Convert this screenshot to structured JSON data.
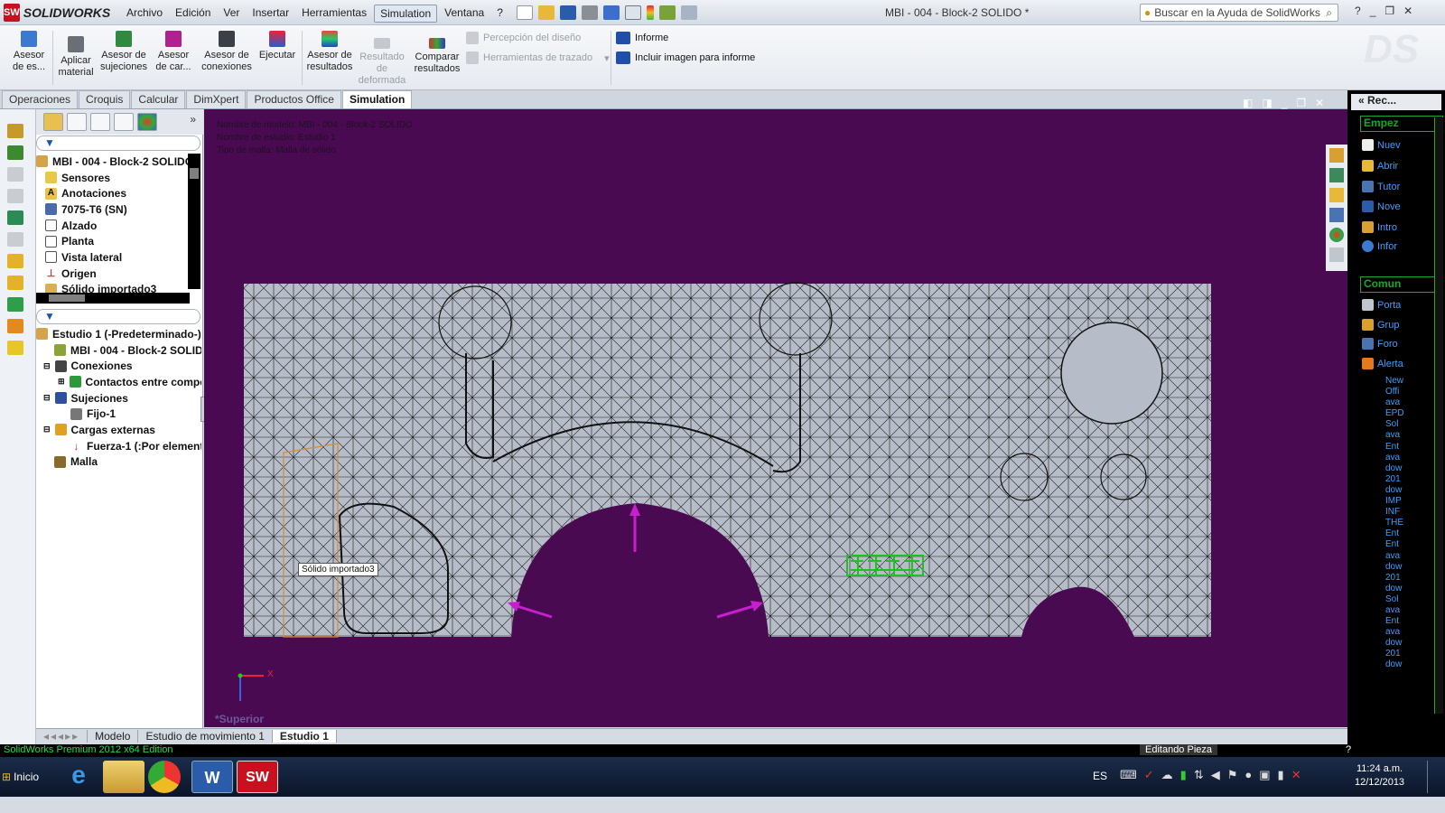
{
  "app": {
    "logo_letters": "SW",
    "logo_text": "SOLIDWORKS",
    "doc_title": "MBI - 004 - Block-2 SOLIDO *"
  },
  "menu": [
    "Archivo",
    "Edición",
    "Ver",
    "Insertar",
    "Herramientas",
    "Simulation",
    "Ventana",
    "?"
  ],
  "help_search": {
    "placeholder": "Buscar en la Ayuda de SolidWorks"
  },
  "ribbon": {
    "buttons": [
      {
        "label": "Asesor de es..."
      },
      {
        "label": "Aplicar material"
      },
      {
        "label": "Asesor de sujeciones"
      },
      {
        "label": "Asesor de car..."
      },
      {
        "label": "Asesor de conexiones"
      },
      {
        "label": "Ejecutar"
      },
      {
        "label": "Asesor de resultados"
      },
      {
        "label": "Resultado de deformada"
      },
      {
        "label": "Comparar resultados"
      }
    ],
    "small": [
      "Percepción del diseño",
      "Herramientas de trazado",
      "Informe",
      "Incluir imagen para informe"
    ]
  },
  "cmd_tabs": [
    "Operaciones",
    "Croquis",
    "Calcular",
    "DimXpert",
    "Productos Office",
    "Simulation"
  ],
  "feature_tree": [
    {
      "label": "MBI - 004 - Block-2 SOLIDO",
      "icon": "part-icon"
    },
    {
      "label": "Sensores",
      "icon": "sensor-icon"
    },
    {
      "label": "Anotaciones",
      "icon": "annotation-icon"
    },
    {
      "label": "7075-T6 (SN)",
      "icon": "material-icon"
    },
    {
      "label": "Alzado",
      "icon": "plane-icon"
    },
    {
      "label": "Planta",
      "icon": "plane-icon"
    },
    {
      "label": "Vista lateral",
      "icon": "plane-icon"
    },
    {
      "label": "Origen",
      "icon": "origin-icon"
    },
    {
      "label": "Sólido importado3",
      "icon": "solid-icon"
    }
  ],
  "study_tree": [
    {
      "label": "Estudio 1 (-Predeterminado-)",
      "icon": "study-icon"
    },
    {
      "label": "MBI - 004 - Block-2 SOLIDO",
      "icon": "part-icon"
    },
    {
      "label": "Conexiones",
      "icon": "connections-icon"
    },
    {
      "label": "Contactos entre componentes",
      "icon": "contact-icon"
    },
    {
      "label": "Sujeciones",
      "icon": "fixture-icon"
    },
    {
      "label": "Fijo-1",
      "icon": "fixed-icon"
    },
    {
      "label": "Cargas externas",
      "icon": "loads-icon"
    },
    {
      "label": "Fuerza-1 (:Por elemento:)",
      "icon": "force-icon"
    },
    {
      "label": "Malla",
      "icon": "mesh-icon"
    }
  ],
  "graphics": {
    "info_lines": [
      "Nombre de modelo: MBI - 004 - Block-2 SOLIDO",
      "Nombre de estudio: Estudio 1",
      "Tipo de malla: Malla de sólido"
    ],
    "tooltip": "Sólido importado3",
    "view_label": "*Superior",
    "axis_x": "X"
  },
  "bottom_tabs": [
    "Modelo",
    "Estudio de movimiento 1",
    "Estudio 1"
  ],
  "task_pane": {
    "header": "« Rec...",
    "section1": "Empez",
    "links1": [
      "Nuev",
      "Abrir",
      "Tutor",
      "Nove",
      "Intro",
      "Infor"
    ],
    "section2": "Comun",
    "links2": [
      "Porta",
      "Grup",
      "Foro",
      "Alerta"
    ],
    "news": [
      "New",
      "Offi",
      "ava",
      "EPD",
      "Sol",
      "ava",
      "Ent",
      "ava",
      "dow",
      "201",
      "dow",
      "IMP",
      "INF",
      "THE",
      "Ent",
      "Ent",
      "ava",
      "dow",
      "201",
      "dow",
      "Sol",
      "ava",
      "Ent",
      "ava",
      "dow",
      "201",
      "dow"
    ]
  },
  "status": {
    "left": "SolidWorks Premium 2012 x64 Edition",
    "right": "Editando Pieza"
  },
  "taskbar": {
    "start": "Inicio",
    "lang": "ES",
    "time": "11:24 a.m.",
    "date": "12/12/2013"
  }
}
